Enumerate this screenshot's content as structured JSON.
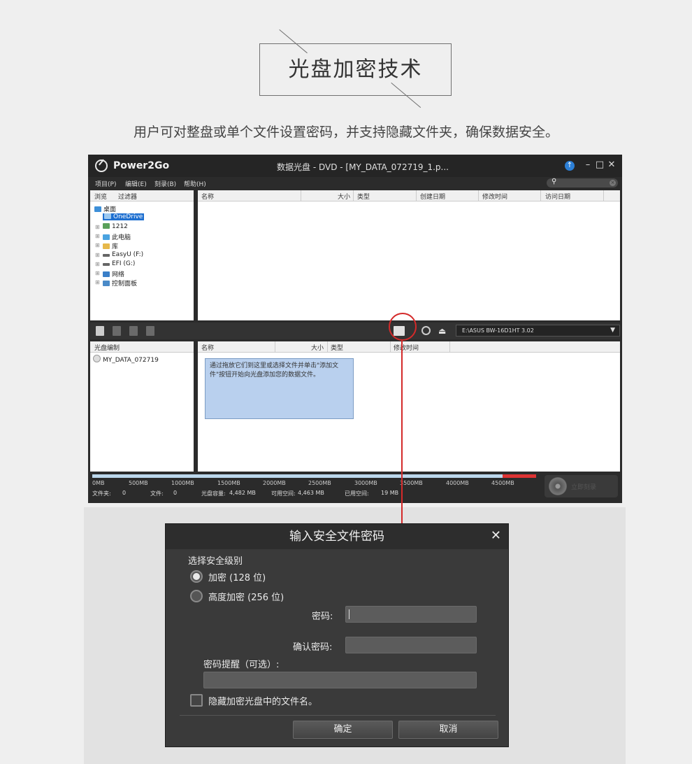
{
  "header": {
    "title": "光盘加密技术",
    "subtitle": "用户可对整盘或单个文件设置密码，并支持隐藏文件夹，确保数据安全。"
  },
  "app": {
    "name": "Power2Go",
    "window_title": "数据光盘 - DVD - [MY_DATA_072719_1.p...",
    "menu": [
      "项目(P)",
      "编辑(E)",
      "刻录(B)",
      "帮助(H)"
    ],
    "browse_tabs": [
      "浏览",
      "过滤器"
    ],
    "tree": [
      "桌面",
      "OneDrive",
      "1212",
      "此电脑",
      "库",
      "EasyU (F:)",
      "EFI (G:)",
      "网络",
      "控制面板"
    ],
    "file_columns": [
      "名称",
      "大小",
      "类型",
      "创建日期",
      "修改时间",
      "访问日期"
    ],
    "drive": "E:\\ASUS BW-16D1HT 3.02",
    "disc_panel_header": "光盘编制",
    "disc_name": "MY_DATA_072719",
    "disc_columns": [
      "名称",
      "大小",
      "类型",
      "修改时间"
    ],
    "hint": "通过拖放它们到这里或选择文件并单击\"添加文件\"按钮开始向光盘添加您的数据文件。",
    "scale": [
      "0MB",
      "500MB",
      "1000MB",
      "1500MB",
      "2000MB",
      "2500MB",
      "3000MB",
      "3500MB",
      "4000MB",
      "4500MB"
    ],
    "status": {
      "folders_label": "文件夹:",
      "folders": "0",
      "files_label": "文件:",
      "files": "0",
      "capacity_label": "光盘容量:",
      "capacity": "4,482 MB",
      "free_label": "可用空间:",
      "free": "4,463 MB",
      "used_label": "已用空间:",
      "used": "19 MB"
    },
    "burn_label": "立即刻录"
  },
  "dialog": {
    "title": "输入安全文件密码",
    "security_level": "选择安全级别",
    "option_128": "加密 (128 位)",
    "option_256": "高度加密 (256 位)",
    "password_label": "密码:",
    "confirm_label": "确认密码:",
    "hint_label": "密码提醒（可选）:",
    "hide_names": "隐藏加密光盘中的文件名。",
    "ok": "确定",
    "cancel": "取消"
  },
  "colors": {
    "accent_red": "#d42a2a",
    "selection_blue": "#1e6fd0",
    "note_blue": "#b9d0ee"
  }
}
